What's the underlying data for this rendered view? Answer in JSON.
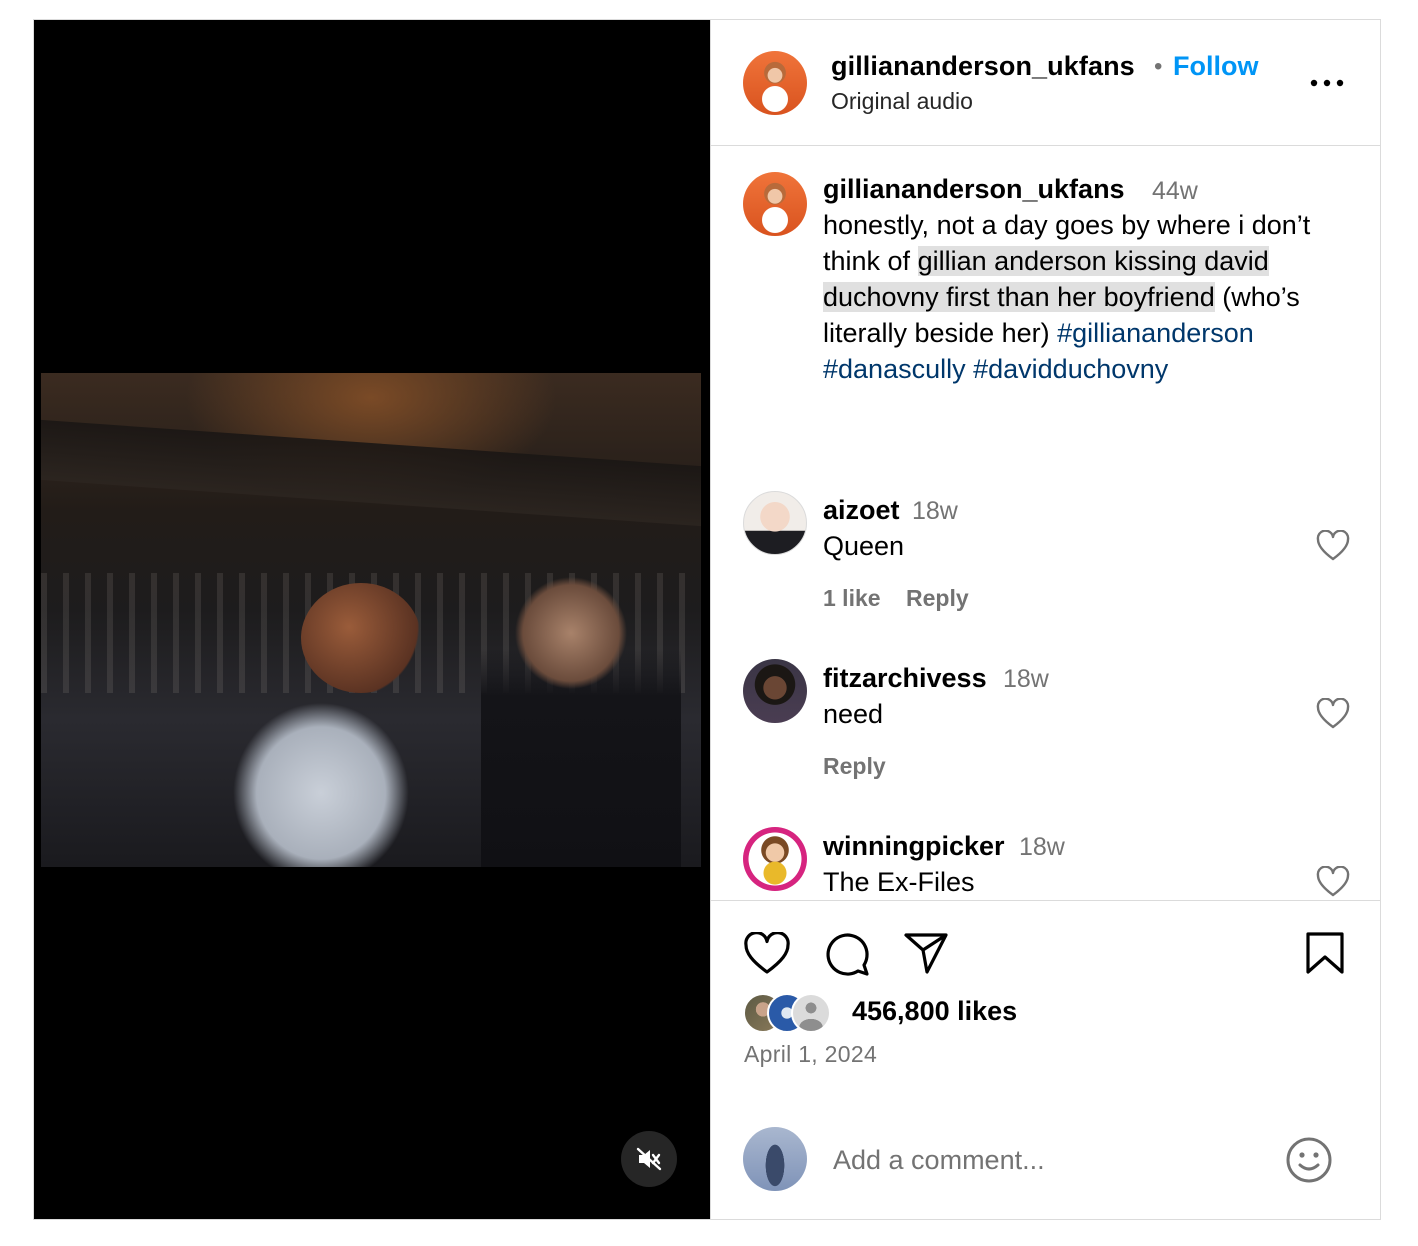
{
  "author": {
    "username": "gilliananderson_ukfans",
    "separator": "•",
    "follow_label": "Follow",
    "subtitle": "Original audio"
  },
  "caption": {
    "username": "gilliananderson_ukfans",
    "time": "44w",
    "text_before": "honestly, not a day goes by where i don’t think of ",
    "text_highlight": "gillian anderson kissing david duchovny first than her boyfriend",
    "text_after": " (who’s literally beside her) ",
    "hashtags": [
      "#gilliananderson",
      "#danascully",
      "#davidduchovny"
    ]
  },
  "comments": [
    {
      "username": "aizoet",
      "time": "18w",
      "text": "Queen",
      "likes": "1 like",
      "reply": "Reply"
    },
    {
      "username": "fitzarchivess",
      "time": "18w",
      "text": "need",
      "reply": "Reply"
    },
    {
      "username": "winningpicker",
      "time": "18w",
      "text": "The Ex-Files"
    }
  ],
  "actions": {
    "icons": [
      "heart-icon",
      "comment-icon",
      "share-icon",
      "bookmark-icon"
    ],
    "likes_count": "456,800 likes",
    "date": "April 1, 2024"
  },
  "add_comment": {
    "placeholder": "Add a comment...",
    "emoji_icon": "emoji-icon"
  },
  "video": {
    "mute_icon": "speaker-muted-icon"
  },
  "colors": {
    "accent": "#0095f6",
    "hashtag": "#00376b",
    "muted_text": "#737373",
    "border": "#dbdbdb",
    "highlight": "#e0e0e0"
  }
}
